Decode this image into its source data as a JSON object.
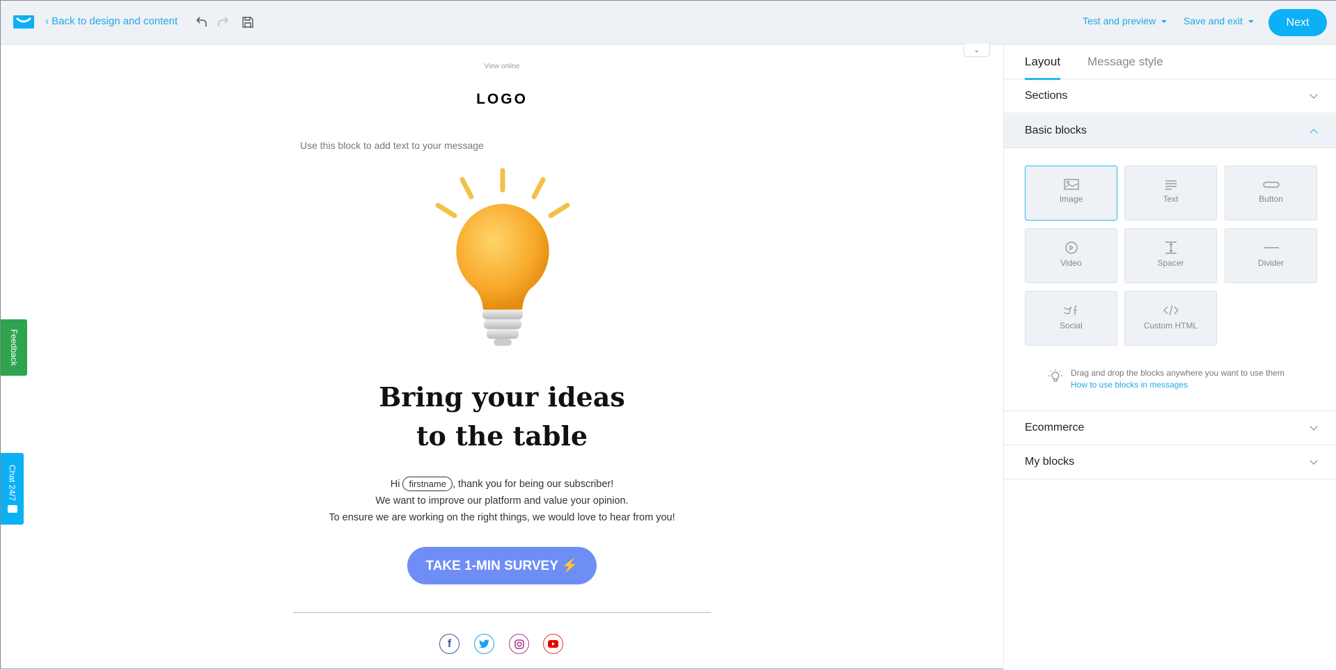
{
  "header": {
    "back_label": "Back to design and content",
    "test_preview": "Test and preview",
    "save_exit": "Save and exit",
    "next": "Next",
    "brand_color": "#0cb0f5"
  },
  "panel": {
    "tabs": [
      {
        "label": "Layout",
        "active": true
      },
      {
        "label": "Message style",
        "active": false
      }
    ],
    "sections": {
      "label": "Sections"
    },
    "basic_blocks": {
      "label": "Basic blocks",
      "expanded": true,
      "blocks": [
        {
          "label": "Image",
          "icon": "image-icon"
        },
        {
          "label": "Text",
          "icon": "text-lines-icon"
        },
        {
          "label": "Button",
          "icon": "button-icon"
        },
        {
          "label": "Video",
          "icon": "play-circle-icon"
        },
        {
          "label": "Spacer",
          "icon": "spacer-icon"
        },
        {
          "label": "Divider",
          "icon": "divider-icon"
        },
        {
          "label": "Social",
          "icon": "social-icon"
        },
        {
          "label": "Custom HTML",
          "icon": "code-icon"
        }
      ],
      "tip": "Drag and drop the blocks anywhere you want to use them",
      "tip_link": "How to use blocks in messages"
    },
    "ecommerce": {
      "label": "Ecommerce"
    },
    "my_blocks": {
      "label": "My blocks"
    }
  },
  "email": {
    "view_online": "View online",
    "logo": "LOGO",
    "text_placeholder": "Use this block to add text to your message",
    "headline_1": "Bring your ideas",
    "headline_2": "to the table",
    "hi": "Hi",
    "merge_tag": "firstname",
    "line1_rest": ", thank you for being our subscriber!",
    "line2": "We want to improve our platform and value your opinion.",
    "line3": "To ensure we are working on the right things, we would love to hear from you!",
    "cta": "TAKE 1-MIN SURVEY ⚡",
    "cta_color": "#6f8ef5",
    "social": [
      "facebook",
      "twitter",
      "instagram",
      "youtube"
    ]
  },
  "side_tabs": {
    "feedback": "Feedback",
    "chat": "Chat 24/7"
  }
}
